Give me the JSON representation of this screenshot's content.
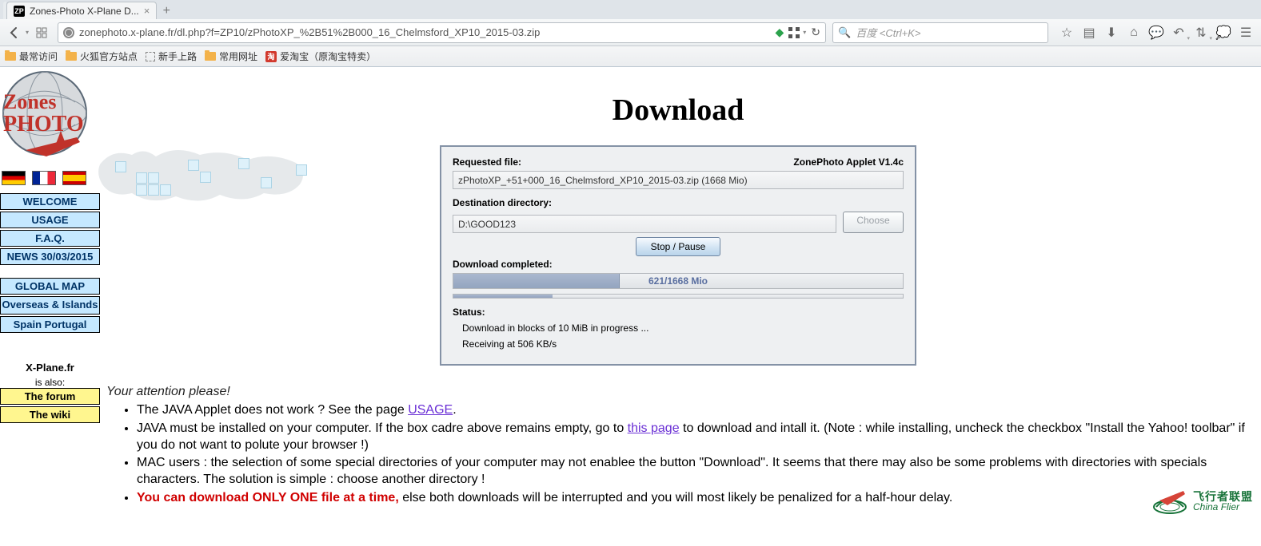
{
  "browser": {
    "tab_title": "Zones-Photo X-Plane D...",
    "url": "zonephoto.x-plane.fr/dl.php?f=ZP10/zPhotoXP_%2B51%2B000_16_Chelmsford_XP10_2015-03.zip",
    "search_placeholder": "百度 <Ctrl+K>"
  },
  "bookmarks": {
    "frequent": "最常访问",
    "firefox_official": "火狐官方站点",
    "getting_started": "新手上路",
    "common_sites": "常用网址",
    "aitaobao": "爱淘宝（原淘宝特卖）"
  },
  "sidebar": {
    "items": [
      {
        "label": "WELCOME"
      },
      {
        "label": "USAGE"
      },
      {
        "label": "F.A.Q."
      },
      {
        "label": "NEWS 30/03/2015"
      }
    ],
    "items2": [
      {
        "label": "GLOBAL MAP"
      },
      {
        "label": "Overseas & Islands"
      },
      {
        "label": "Spain Portugal"
      }
    ],
    "xplane_label": "X-Plane.fr",
    "also_label": "is also:",
    "forum_label": "The forum",
    "wiki_label": "The wiki"
  },
  "page_title": "Download",
  "applet": {
    "requested_label": "Requested file:",
    "version": "ZonePhoto Applet V1.4c",
    "requested_file": "zPhotoXP_+51+000_16_Chelmsford_XP10_2015-03.zip (1668 Mio)",
    "dest_label": "Destination directory:",
    "dest_value": "D:\\GOOD123",
    "choose_label": "Choose",
    "stop_label": "Stop / Pause",
    "completed_label": "Download completed:",
    "progress_text": "621/1668 Mio",
    "progress_pct": 37,
    "mini_pct": 22,
    "status_label": "Status:",
    "status_line1": "Download in blocks of 10 MiB in progress ...",
    "status_line2": "Receiving at 506 KB/s"
  },
  "notes": {
    "attention": "Your attention please!",
    "li1a": "The JAVA Applet does not work ? See the page ",
    "li1_link": "USAGE",
    "li1b": ".",
    "li2a": "JAVA must be installed on your computer. If the box cadre above remains empty, go to ",
    "li2_link": "this page",
    "li2b": " to download and intall it. (Note : while installing, uncheck the checkbox \"Install the Yahoo! toolbar\" if you do not want to polute your browser !)",
    "li3": "MAC users : the selection of some special directories of your computer may not enablee the button \"Download\". It seems that there may also be some problems with directories with specials characters. The solution is simple : choose another directory !",
    "li4_red": "You can download ONLY ONE file at a time,",
    "li4_rest": " else both downloads will be interrupted and you will most likely be penalized for a half-hour delay."
  },
  "watermark": {
    "cn": "飞行者联盟",
    "en": "China Flier"
  }
}
